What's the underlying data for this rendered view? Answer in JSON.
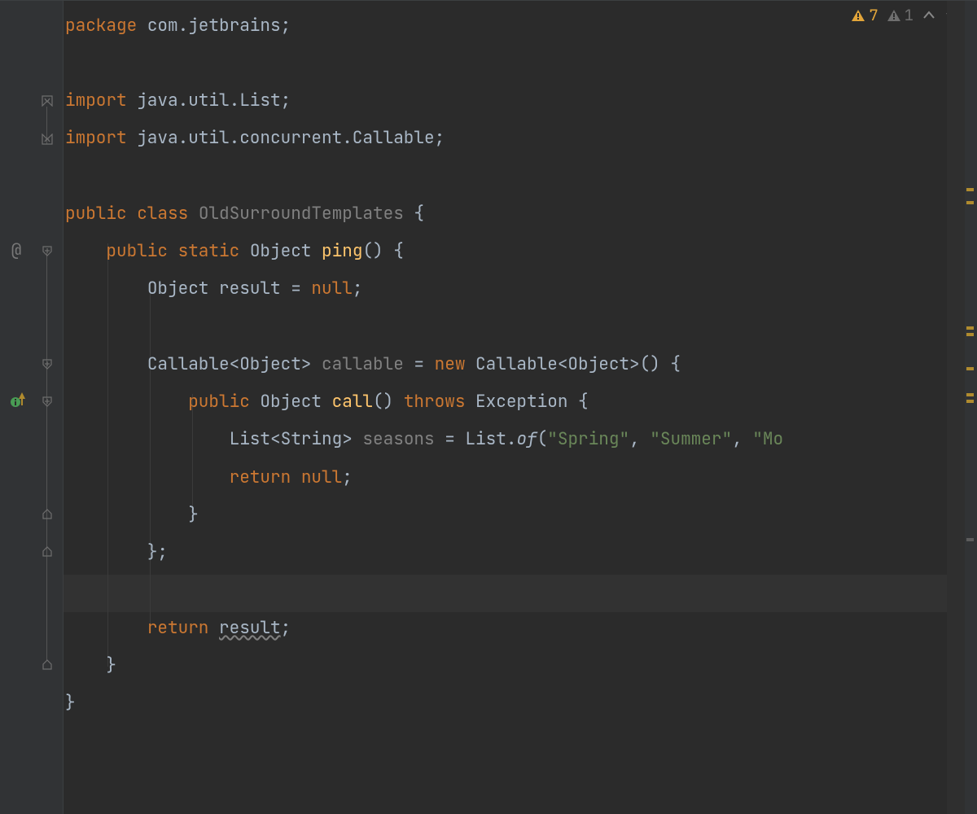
{
  "inspections": {
    "warning_count": "7",
    "weak_warning_count": "1"
  },
  "gutter": {
    "override_symbol": "@"
  },
  "code": {
    "l1_kw": "package ",
    "l1_pkg": "com.jetbrains",
    "l1_sc": ";",
    "l3_kw": "import ",
    "l3_pkg": "java.util.List",
    "l3_sc": ";",
    "l4_kw": "import ",
    "l4_pkg": "java.util.concurrent.Callable",
    "l4_sc": ";",
    "l6_mods": "public class ",
    "l6_name": "OldSurroundTemplates ",
    "l6_brace": "{",
    "l7_indent": "    ",
    "l7_mods": "public static ",
    "l7_type": "Object ",
    "l7_name": "ping",
    "l7_rest": "() {",
    "l8_indent": "        ",
    "l8_type": "Object ",
    "l8_var": "result = ",
    "l8_kw": "null",
    "l8_sc": ";",
    "l10_indent": "        ",
    "l10_a": "Callable<Object> ",
    "l10_b": "callable ",
    "l10_c": "= ",
    "l10_kw": "new ",
    "l10_d": "Callable<Object>() {",
    "l11_indent": "            ",
    "l11_mods": "public ",
    "l11_type": "Object ",
    "l11_name": "call",
    "l11_paren": "() ",
    "l11_kw": "throws ",
    "l11_exc": "Exception {",
    "l12_indent": "                ",
    "l12_a": "List<String> ",
    "l12_b": "seasons ",
    "l12_c": "= List.",
    "l12_of": "of",
    "l12_paren": "(",
    "l12_s1": "\"Spring\"",
    "l12_comma1": ", ",
    "l12_s2": "\"Summer\"",
    "l12_comma2": ", ",
    "l12_s3": "\"Mo",
    "l13_indent": "                ",
    "l13_kw": "return ",
    "l13_val": "null",
    "l13_sc": ";",
    "l14_indent": "            ",
    "l14_brace": "}",
    "l15_indent": "        ",
    "l15_brace": "};",
    "l17_indent": "        ",
    "l17_kw": "return ",
    "l17_var": "result",
    "l17_sc": ";",
    "l18_indent": "    ",
    "l18_brace": "}",
    "l19_brace": "}"
  }
}
